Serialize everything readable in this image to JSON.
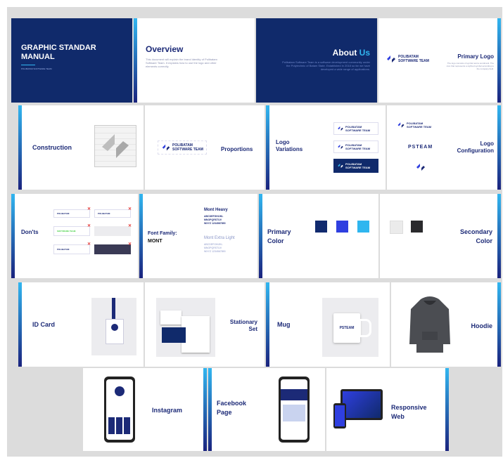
{
  "slides": {
    "cover": {
      "title": "GRAPHIC STANDAR MANUAL",
      "subtitle": "POLIBATAM SOFTWARE TEAM"
    },
    "overview": {
      "title": "Overview",
      "body": "This document will explain the brand identity of Polibatam Software Team. It explains how to use the logo and other elements correctly."
    },
    "about": {
      "title_a": "About",
      "title_b": "Us",
      "body": "Polibatam Software Team is a software development community under the Polytechnic of Batam State. Established in 2018 so far we have developed a wide range of applications."
    },
    "primary_logo": {
      "title": "Primary Logo",
      "logo_line1": "POLIBATAM",
      "logo_line2": "SOFTWARE TEAM",
      "body": "The logo consists of symbol and a wordmark. The icon that represents a stylized symbol according to the company field."
    },
    "construction": {
      "title": "Construction"
    },
    "proportions": {
      "title": "Proportions",
      "logo_line1": "POLIBATAM",
      "logo_line2": "SOFTWARE TEAM"
    },
    "variations": {
      "title_a": "Logo",
      "title_b": "Variations",
      "logo_line1": "POLIBATAM",
      "logo_line2": "SOFTWARE TEAM"
    },
    "configuration": {
      "title_a": "Logo",
      "title_b": "Configuration",
      "wordmark": "PSTEAM",
      "logo_line1": "POLIBATAM",
      "logo_line2": "SOFTWARE TEAM"
    },
    "donts": {
      "title": "Don'ts",
      "logo_line1": "POLIBATAM",
      "logo_line2": "SOFTWARE TEAM"
    },
    "font": {
      "label": "Font Family:",
      "name": "MONT",
      "heavy": "Mont Heavy",
      "heavy_chars1": "ABCDEFGHIJKL",
      "heavy_chars2": "MNOPQRSTUV",
      "heavy_chars3": "WXYZ 1234567890",
      "light": "Mont Extra Light",
      "light_chars1": "ABCDEFGHIJKL",
      "light_chars2": "MNOPQRSTUV",
      "light_chars3": "WXYZ 1234567890"
    },
    "primary_color": {
      "title_a": "Primary",
      "title_b": "Color"
    },
    "secondary_color": {
      "title_a": "Secondary",
      "title_b": "Color"
    },
    "id_card": {
      "title": "ID Card"
    },
    "stationary": {
      "title_a": "Stationary",
      "title_b": "Set"
    },
    "mug": {
      "title": "Mug",
      "mug_text": "PSTEAM"
    },
    "hoodie": {
      "title": "Hoodie"
    },
    "instagram": {
      "title": "Instagram"
    },
    "facebook": {
      "title_a": "Facebook",
      "title_b": "Page"
    },
    "web": {
      "title_a": "Responsive",
      "title_b": "Web"
    }
  },
  "colors": {
    "primary": [
      "#112a6e",
      "#2f3fe0",
      "#2fb6ef"
    ],
    "secondary": [
      "#ebebeb",
      "#2a2a2d"
    ],
    "navy": "#102a6b"
  }
}
